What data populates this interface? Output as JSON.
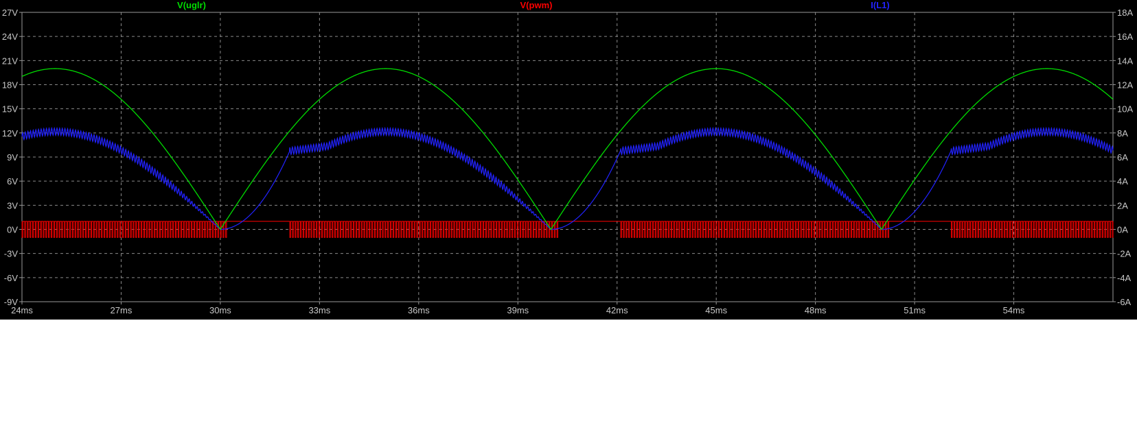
{
  "chart_data": {
    "type": "line",
    "title": "",
    "grid": true,
    "legend_placement": "top",
    "background": "#000000",
    "x_axis": {
      "label": "",
      "range_ms": [
        24,
        57
      ],
      "ticks": [
        24,
        27,
        30,
        33,
        36,
        39,
        42,
        45,
        48,
        51,
        54
      ],
      "tick_labels": [
        "24ms",
        "27ms",
        "30ms",
        "33ms",
        "36ms",
        "39ms",
        "42ms",
        "45ms",
        "48ms",
        "51ms",
        "54ms"
      ]
    },
    "y_left_axis": {
      "label": "",
      "unit": "V",
      "range": [
        -9,
        27
      ],
      "ticks": [
        27,
        24,
        21,
        18,
        15,
        12,
        9,
        6,
        3,
        0,
        -3,
        -6,
        -9
      ],
      "tick_labels": [
        "27V",
        "24V",
        "21V",
        "18V",
        "15V",
        "12V",
        "9V",
        "6V",
        "3V",
        "0V",
        "-3V",
        "-6V",
        "-9V"
      ]
    },
    "y_right_axis": {
      "label": "",
      "unit": "A",
      "range": [
        -6,
        18
      ],
      "ticks": [
        18,
        16,
        14,
        12,
        10,
        8,
        6,
        4,
        2,
        0,
        -2,
        -4,
        -6
      ],
      "tick_labels": [
        "18A",
        "16A",
        "14A",
        "12A",
        "10A",
        "8A",
        "6A",
        "4A",
        "2A",
        "0A",
        "-2A",
        "-4A",
        "-6A"
      ]
    },
    "series": [
      {
        "name": "V(uglr)",
        "color": "#00dd00",
        "axis": "left",
        "shape": "full-wave rectified sine",
        "amplitude_V": 20,
        "period_ms": 10,
        "zero_crossings_ms": [
          30,
          40,
          50
        ],
        "peaks_ms": [
          25,
          35,
          45,
          55
        ],
        "x": [
          24,
          25,
          26,
          27,
          28,
          29,
          30,
          31,
          32,
          33,
          34,
          35,
          36,
          37,
          38,
          39,
          40,
          41,
          42,
          43,
          44,
          45,
          46,
          47,
          48,
          49,
          50,
          51,
          52,
          53,
          54,
          55,
          56,
          57
        ],
        "values": [
          19.0,
          20.0,
          19.0,
          16.2,
          11.8,
          6.2,
          0,
          6.2,
          11.8,
          16.2,
          19.0,
          20.0,
          19.0,
          16.2,
          11.8,
          6.2,
          0,
          6.2,
          11.8,
          16.2,
          19.0,
          20.0,
          19.0,
          16.2,
          11.8,
          6.2,
          0,
          6.2,
          11.8,
          16.2,
          19.0,
          20.0,
          19.0,
          16.2
        ]
      },
      {
        "name": "V(pwm)",
        "color": "#ff0000",
        "axis": "left",
        "shape": "PWM pulse train",
        "high_V": 1,
        "low_V": -1,
        "switching_intervals_ms": [
          [
            24,
            30.2
          ],
          [
            32.1,
            40.2
          ],
          [
            42.1,
            50.2
          ],
          [
            52.1,
            57
          ]
        ],
        "idle_level_V": 1
      },
      {
        "name": "I(L1)",
        "color": "#2222ff",
        "axis": "right",
        "shape": "rectified current with ripple",
        "peak_A": 8.1,
        "ripple_A": 0.3,
        "zero_points_ms": [
          30,
          40,
          50
        ],
        "step_points_ms": [
          32.1,
          42.1,
          52.1
        ],
        "x": [
          24,
          25,
          26,
          27,
          28,
          29,
          30,
          30.5,
          31,
          31.5,
          32,
          32.1,
          33,
          34,
          35,
          36,
          37,
          38,
          39,
          40,
          40.5,
          41,
          41.5,
          42,
          42.1,
          43,
          44,
          45,
          46,
          47,
          48,
          49,
          50,
          50.5,
          51,
          51.5,
          52,
          52.1,
          53,
          54,
          55,
          56,
          57
        ],
        "values": [
          7.8,
          8.1,
          7.8,
          6.6,
          4.7,
          2.4,
          0,
          0.2,
          0.9,
          2.5,
          4.8,
          6.5,
          6.9,
          7.7,
          8.1,
          7.7,
          6.6,
          4.7,
          2.4,
          0,
          0.2,
          0.9,
          2.5,
          4.8,
          6.5,
          6.9,
          7.7,
          8.1,
          7.7,
          6.6,
          4.7,
          2.4,
          0,
          0.2,
          0.9,
          2.5,
          4.8,
          6.5,
          6.9,
          7.7,
          8.1,
          7.7,
          6.6
        ]
      }
    ]
  }
}
